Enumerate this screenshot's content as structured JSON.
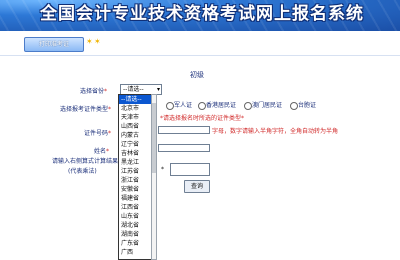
{
  "header": {
    "title": "全国会计专业技术资格考试网上报名系统"
  },
  "toolbar": {
    "print_tab": "打印准考证"
  },
  "form": {
    "section_title": "初级",
    "province_label": "选择省份",
    "cert_type_label": "选择报考证件类型",
    "cert_no_label": "证件号码",
    "name_label": "姓名",
    "captcha_label_line1": "请输入右侧算式计算结果",
    "captcha_label_line2": "(代表乘法)",
    "required_mark": "*",
    "cert_type_notice": "*请选择报名时所选的证件类型*",
    "cert_no_hint": "字母，数字请输入半角字符，全角自动转为半角",
    "query_button": "查询",
    "captcha_prefix": "*"
  },
  "select_province": {
    "selected": "--请选--",
    "options": [
      "--请选--",
      "北京市",
      "天津市",
      "山西省",
      "内蒙古",
      "辽宁省",
      "吉林省",
      "黑龙江",
      "江苏省",
      "浙江省",
      "安徽省",
      "福建省",
      "江西省",
      "山东省",
      "湖北省",
      "湖南省",
      "广东省",
      "广西"
    ]
  },
  "cert_type_options": [
    "军人证",
    "香港居民证",
    "澳门居民证",
    "台胞证"
  ]
}
